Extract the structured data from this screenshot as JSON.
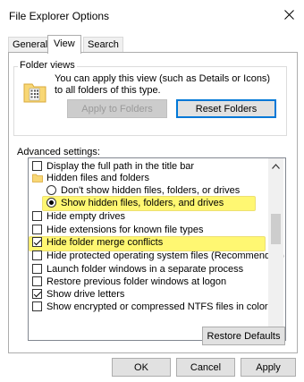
{
  "dialog": {
    "title": "File Explorer Options",
    "close_label": "✕"
  },
  "tabs": [
    {
      "label": "General"
    },
    {
      "label": "View"
    },
    {
      "label": "Search"
    }
  ],
  "folder_views": {
    "group_label": "Folder views",
    "description": "You can apply this view (such as Details or Icons) to all folders of this type.",
    "apply_button": "Apply to Folders",
    "reset_button": "Reset Folders"
  },
  "advanced": {
    "label": "Advanced settings:",
    "items": [
      {
        "type": "checkbox",
        "checked": false,
        "label": "Display the full path in the title bar"
      },
      {
        "type": "folder",
        "label": "Hidden files and folders"
      },
      {
        "type": "radio",
        "checked": false,
        "label": "Don't show hidden files, folders, or drives"
      },
      {
        "type": "radio",
        "checked": true,
        "label": "Show hidden files, folders, and drives",
        "highlighted": true
      },
      {
        "type": "checkbox",
        "checked": false,
        "label": "Hide empty drives"
      },
      {
        "type": "checkbox",
        "checked": false,
        "label": "Hide extensions for known file types"
      },
      {
        "type": "checkbox",
        "checked": true,
        "label": "Hide folder merge conflicts"
      },
      {
        "type": "checkbox",
        "checked": false,
        "label": "Hide protected operating system files (Recommended)",
        "highlighted": true
      },
      {
        "type": "checkbox",
        "checked": false,
        "label": "Launch folder windows in a separate process"
      },
      {
        "type": "checkbox",
        "checked": false,
        "label": "Restore previous folder windows at logon"
      },
      {
        "type": "checkbox",
        "checked": true,
        "label": "Show drive letters"
      },
      {
        "type": "checkbox",
        "checked": false,
        "label": "Show encrypted or compressed NTFS files in color"
      }
    ],
    "restore_button": "Restore Defaults"
  },
  "footer": {
    "ok": "OK",
    "cancel": "Cancel",
    "apply": "Apply"
  },
  "colors": {
    "highlight": "#fff200",
    "accent": "#0078d7"
  }
}
